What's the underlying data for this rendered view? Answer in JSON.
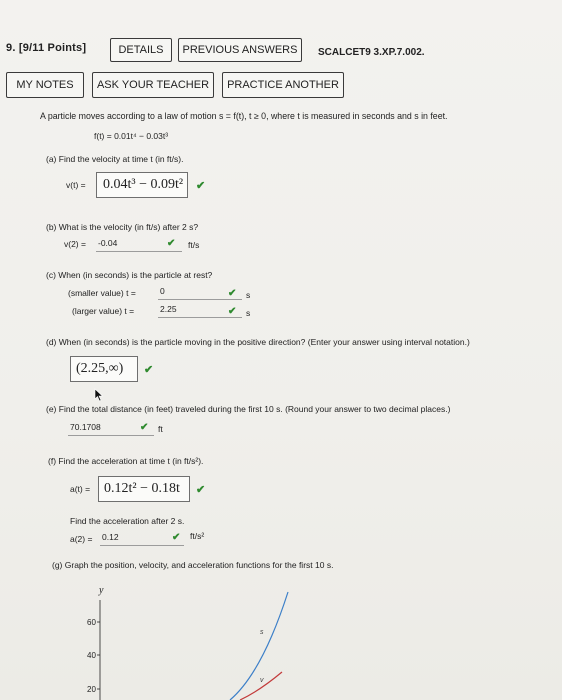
{
  "header": {
    "question": "9. [9/11 Points]",
    "details_btn": "DETAILS",
    "previous_btn": "PREVIOUS ANSWERS",
    "code": "SCALCET9 3.XP.7.002."
  },
  "toolbar": {
    "mynotes": "MY NOTES",
    "askteacher": "ASK YOUR TEACHER",
    "practice": "PRACTICE ANOTHER"
  },
  "problem": {
    "intro": "A particle moves according to a law of motion s = f(t), t ≥ 0, where t is measured in seconds and s in feet.",
    "equation": "f(t) = 0.01t⁴ − 0.03t³"
  },
  "partA": {
    "label": "(a)  Find the velocity at time t (in ft/s).",
    "prefix": "v(t) =",
    "answer": "0.04t³ − 0.09t²"
  },
  "partB": {
    "label": "(b)  What is the velocity (in ft/s) after 2 s?",
    "prefix": "v(2) =",
    "answer": "-0.04",
    "unit": "ft/s"
  },
  "partC": {
    "label": "(c)  When (in seconds) is the particle at rest?",
    "small_label": "(smaller value) t =",
    "small_answer": "0",
    "large_label": "(larger value) t =",
    "large_answer": "2.25",
    "unit": "s"
  },
  "partD": {
    "label": "(d)  When (in seconds) is the particle moving in the positive direction? (Enter your answer using interval notation.)",
    "answer": "(2.25,∞)"
  },
  "partE": {
    "label": "(e)  Find the total distance (in feet) traveled during the first 10 s. (Round your answer to two decimal places.)",
    "answer": "70.1708",
    "unit": "ft"
  },
  "partF": {
    "label": "(f)  Find the acceleration at time t (in ft/s²).",
    "prefix": "a(t) =",
    "answer": "0.12t² − 0.18t",
    "label2": "Find the acceleration after 2 s.",
    "prefix2": "a(2) =",
    "answer2": "0.12",
    "unit2": "ft/s²"
  },
  "partG": {
    "label": "(g)  Graph the position, velocity, and acceleration functions for the first 10 s."
  },
  "chart_data": {
    "type": "line",
    "ylabel": "y",
    "yticks": [
      20,
      40,
      60
    ],
    "series_labels": [
      "s",
      "v"
    ]
  },
  "check_mark": "✔"
}
